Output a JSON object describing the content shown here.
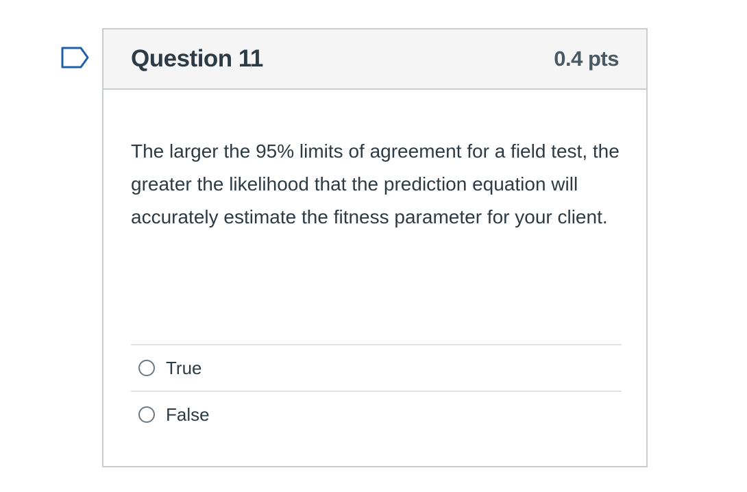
{
  "question": {
    "title": "Question 11",
    "points": "0.4 pts",
    "text": "The larger the 95% limits of agreement for a field test, the greater the likelihood that the prediction equation will accurately estimate the fitness parameter for your client.",
    "flag_icon": "flag-icon",
    "answers": [
      {
        "label": "True",
        "selected": false
      },
      {
        "label": "False",
        "selected": false
      }
    ]
  },
  "colors": {
    "border": "#c7cdd1",
    "header_bg": "#f5f5f5",
    "text": "#2d3b45",
    "flag": "#1f5fa8"
  }
}
